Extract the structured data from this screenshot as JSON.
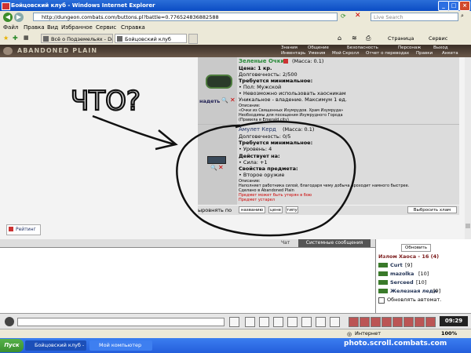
{
  "window": {
    "title": "Бойцовский клуб - Windows Internet Explorer"
  },
  "address": {
    "url": "http://dungeon.combats.com/buttons.pl?battle=0.776524836882588",
    "search_placeholder": "Live Search"
  },
  "menu": [
    "Файл",
    "Правка",
    "Вид",
    "Избранное",
    "Сервис",
    "Справка"
  ],
  "tabs": [
    {
      "label": "Всё о Подземельях - DarkCl..."
    },
    {
      "label": "Бойцовский клуб"
    }
  ],
  "tab_tools": {
    "page": "Страница",
    "service": "Сервис"
  },
  "game": {
    "logo": "ABANDONED PLAIN",
    "nav_top": [
      "Знания",
      "Общение",
      "Безопасность",
      "Персонаж",
      "Выход"
    ],
    "nav_bottom": [
      "Инвентарь",
      "Умения",
      "Мой Скролл",
      "Отчет о переводах",
      "Правки",
      "Анкета"
    ]
  },
  "item1": {
    "name": "Зеленые Очки",
    "mass": "(Масса: 0.1)",
    "price": "Цена: 1 кр.",
    "durability": "Долговечность: 2/500",
    "req_title": "Требуется минимальное:",
    "req": [
      "• Пол: Мужской",
      "• Невозможно использовать хаосникам"
    ],
    "unique": "Уникальное - владение. Максимум 1 ед.",
    "desc_label": "Описание:",
    "desc": [
      "«Очки из Священных Изумрудов. Храм Изумруда»",
      "Необходимы для посещения Изумрудного Города",
      "(Правила в Emerald.city)"
    ],
    "action": "надеть"
  },
  "item2": {
    "name": "Амулет Керд",
    "mass": "(Масса: 0.1)",
    "durability": "Долговечность: 0/5",
    "req_title": "Требуется минимальное:",
    "req": [
      "• Уровень: 4"
    ],
    "acts_title": "Действует на:",
    "acts": [
      "• Сила: +1"
    ],
    "props_title": "Свойства предмета:",
    "props": [
      "• Второе оружие"
    ],
    "desc_label": "Описание:",
    "desc": "Наполняет работника силой, благодаря чему добыча проходит намного быстрее.",
    "made": "Сделано в Abandoned Plain",
    "warn1": "Предмет может быть утерян в бою",
    "warn2": "Предмет устарел"
  },
  "sort": {
    "label": "ыровнять по",
    "by_name": "названию",
    "by_price": "цене",
    "by_type": "типу",
    "throw": "Выбросить хлам"
  },
  "rating": "Рейтинг",
  "annotation": {
    "text": "ЧТО?"
  },
  "chat": {
    "tab_chat": "Чат",
    "tab_sys": "Системные сообщения"
  },
  "room": {
    "refresh": "Обновить",
    "title": "Излом Хаоса - 16 (4)",
    "players": [
      {
        "name": "Curt",
        "level": "[9]"
      },
      {
        "name": "mazolka",
        "level": "[10]"
      },
      {
        "name": "Serceed",
        "level": "[10]"
      },
      {
        "name": "Железная леди",
        "level": "[9]"
      }
    ],
    "auto": "Обновлять автомат."
  },
  "clock": "09:29",
  "status": {
    "zone": "Интернет",
    "zoom": "100%"
  },
  "taskbar": {
    "start": "Пуск",
    "tasks": [
      "Бойцовский клуб - ...",
      "Мой компьютер"
    ],
    "watermark": "photo.scroll.combats.com"
  }
}
